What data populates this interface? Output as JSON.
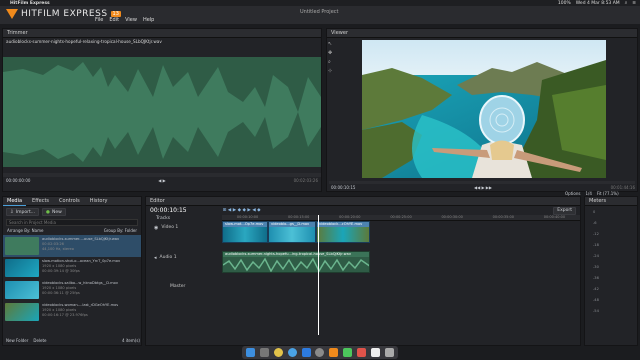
{
  "system_menu": {
    "apple": "",
    "app_name": "HitFilm Express",
    "clock": "Wed 4 Mar  8:53 AM",
    "battery": "100%"
  },
  "app": {
    "logo_text": "HITFILM EXPRESS",
    "version": "13",
    "window_title": "Untitled Project",
    "menu": [
      "File",
      "Edit",
      "View",
      "Help"
    ]
  },
  "trimmer": {
    "title": "Trimmer",
    "filename": "audioblocks-summer-nights-hopeful-relaxing-tropical-house_SLbQJKtjr.wav",
    "timecode_start": "00:00:00:00",
    "timecode_end": "00:02:03:26"
  },
  "viewer": {
    "title": "Viewer",
    "timecode_start": "00:00:10:15",
    "timecode_end": "00:01:44:16",
    "options_label": "Options",
    "quality": "1/4",
    "zoom": "Fit (77.1%)"
  },
  "media_panel": {
    "tabs": [
      "Media",
      "Effects",
      "Controls",
      "History"
    ],
    "import_label": "Import...",
    "new_label": "New",
    "search_placeholder": "Search in Project Media",
    "arrange_label": "Arrange By: Name",
    "group_label": "Group By: Folder",
    "items": [
      {
        "name": "audioblocks-summer-...ouse_SLbQJKtjr.wav",
        "meta1": "00:02:03:26",
        "meta2": "44,100 Hz, stereo"
      },
      {
        "name": "slow-motion-shot-o...ocean_YrcT_0p7e.mov",
        "meta1": "1920 x 1080 pixels",
        "meta2": "00:00:39:14 @ 30fps"
      },
      {
        "name": "videoblocks-sailbo...w_hknoDbtgs__D.mov",
        "meta1": "1920 x 1080 pixels",
        "meta2": "00:00:36:11 @ 25fps"
      },
      {
        "name": "videoblocks-woman-...last_rDGeOhYE.mov",
        "meta1": "1920 x 1080 pixels",
        "meta2": "00:00:16:17 @ 23.976fps"
      }
    ],
    "new_folder_label": "New Folder",
    "delete_label": "Delete",
    "item_count": "4 item(s)"
  },
  "editor": {
    "title": "Editor",
    "timecode": "00:00:10:15",
    "tracks_label": "Tracks",
    "export_label": "Export",
    "video_track": "Video 1",
    "audio_track": "Audio 1",
    "master_label": "Master",
    "ruler_marks": [
      "00:00:10:00",
      "00:00:15:00",
      "00:00:20:00",
      "00:00:25:00",
      "00:00:30:00",
      "00:00:35:00",
      "00:00:40:00"
    ],
    "video_clips": [
      {
        "label": "slow-mot...Op7e.mov"
      },
      {
        "label": "videoblo...gs__D.mov"
      },
      {
        "label": "videoblock...cOhYE.mov"
      }
    ],
    "audio_clip_label": "audioblocks-summer-nights-hopefu...ing-tropical-house_SLbQJKtjr.wav"
  },
  "meters": {
    "title": "Meters",
    "scale": [
      "0",
      "-6",
      "-12",
      "-18",
      "-24",
      "-30",
      "-36",
      "-42",
      "-48",
      "-54"
    ]
  },
  "colors": {
    "accent": "#f08a1c",
    "waveform": "#3f7b5e",
    "video_clip": "#3a6f9b",
    "audio_clip": "#3b7358",
    "playhead": "#ffffff"
  }
}
